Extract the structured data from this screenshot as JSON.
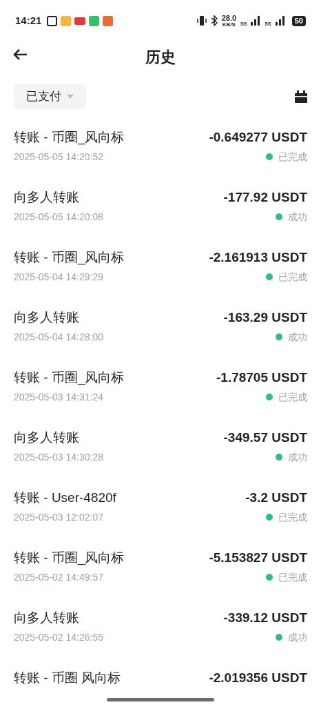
{
  "status_bar": {
    "time": "14:21",
    "speed": "28.0",
    "speed_unit": "KB/S",
    "network_1": "5G",
    "network_2": "5G",
    "battery": "50"
  },
  "header": {
    "title": "历史"
  },
  "filter": {
    "label": "已支付"
  },
  "transactions": [
    {
      "title": "转账 - 币圈_风向标",
      "date": "2025-05-05 14:20:52",
      "amount": "-0.649277 USDT",
      "status": "已完成",
      "color": "#2ebd85"
    },
    {
      "title": "向多人转账",
      "date": "2025-05-05 14:20:08",
      "amount": "-177.92 USDT",
      "status": "成功",
      "color": "#2ebd85"
    },
    {
      "title": "转账 - 币圈_风向标",
      "date": "2025-05-04 14:29:29",
      "amount": "-2.161913 USDT",
      "status": "已完成",
      "color": "#2ebd85"
    },
    {
      "title": "向多人转账",
      "date": "2025-05-04 14:28:00",
      "amount": "-163.29 USDT",
      "status": "成功",
      "color": "#2ebd85"
    },
    {
      "title": "转账 - 币圈_风向标",
      "date": "2025-05-03 14:31:24",
      "amount": "-1.78705 USDT",
      "status": "已完成",
      "color": "#2ebd85"
    },
    {
      "title": "向多人转账",
      "date": "2025-05-03 14:30:28",
      "amount": "-349.57 USDT",
      "status": "成功",
      "color": "#2ebd85"
    },
    {
      "title": "转账 - User-4820f",
      "date": "2025-05-03 12:02:07",
      "amount": "-3.2 USDT",
      "status": "已完成",
      "color": "#2ebd85"
    },
    {
      "title": "转账 - 币圈_风向标",
      "date": "2025-05-02 14:49:57",
      "amount": "-5.153827 USDT",
      "status": "已完成",
      "color": "#2ebd85"
    },
    {
      "title": "向多人转账",
      "date": "2025-05-02 14:26:55",
      "amount": "-339.12 USDT",
      "status": "成功",
      "color": "#2ebd85"
    },
    {
      "title": "转账 - 币圈 风向标",
      "amount": "-2.019356 USDT"
    }
  ]
}
